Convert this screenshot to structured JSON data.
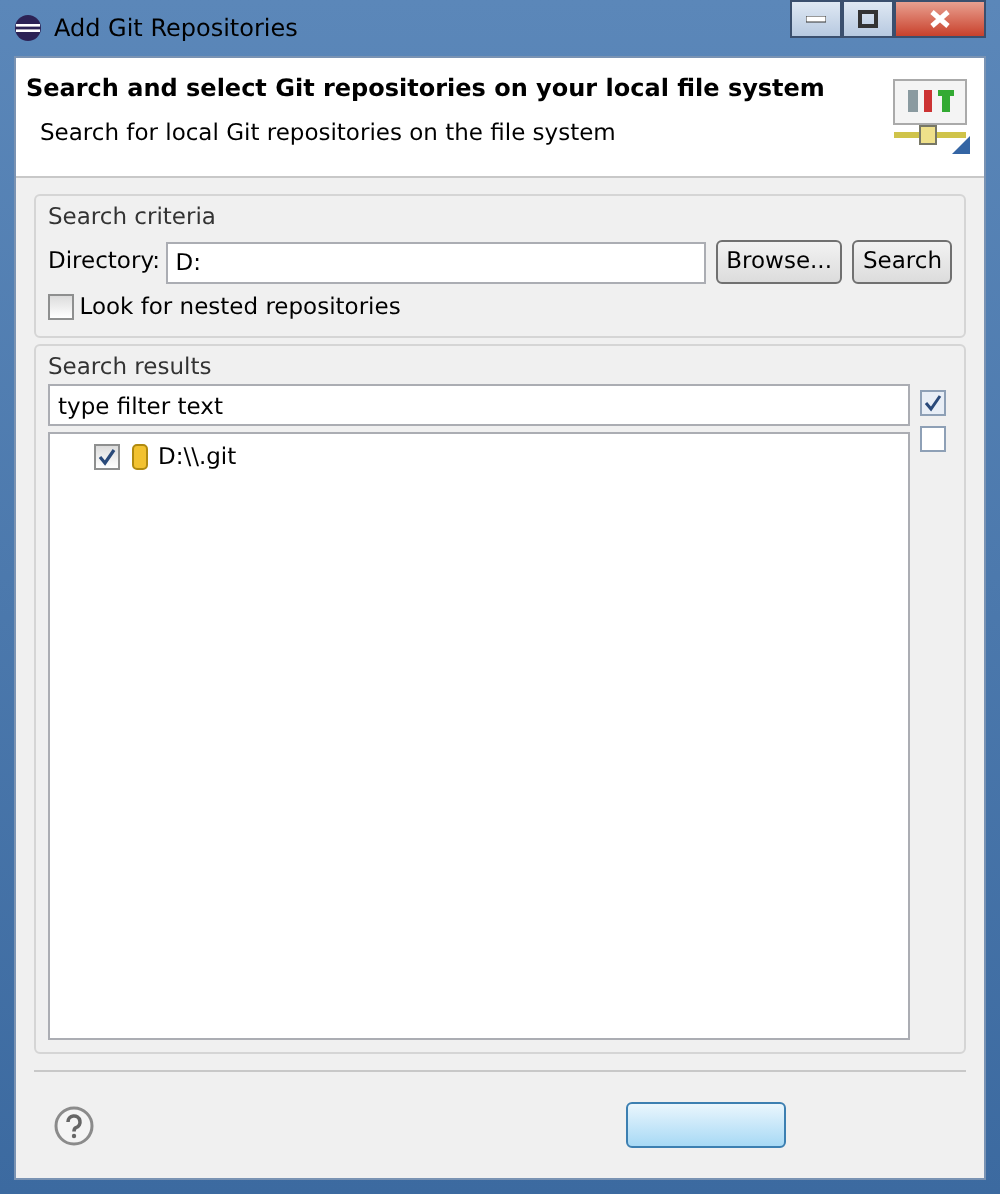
{
  "window": {
    "title": "Add Git Repositories"
  },
  "header": {
    "title": "Search and select Git repositories on your local file system",
    "subtitle": "Search for local Git repositories on the file system"
  },
  "search_criteria": {
    "label": "Search criteria",
    "directory_label": "Directory:",
    "directory_value": "D:",
    "buttons": [
      "Browse...",
      "Search"
    ],
    "nested": {
      "label": "Look for nested repositories",
      "checked": false
    }
  },
  "search_results": {
    "label": "Search results",
    "filter_value": "type filter text",
    "items": [
      {
        "label": "D:\\\\.git",
        "checked": true
      }
    ]
  }
}
